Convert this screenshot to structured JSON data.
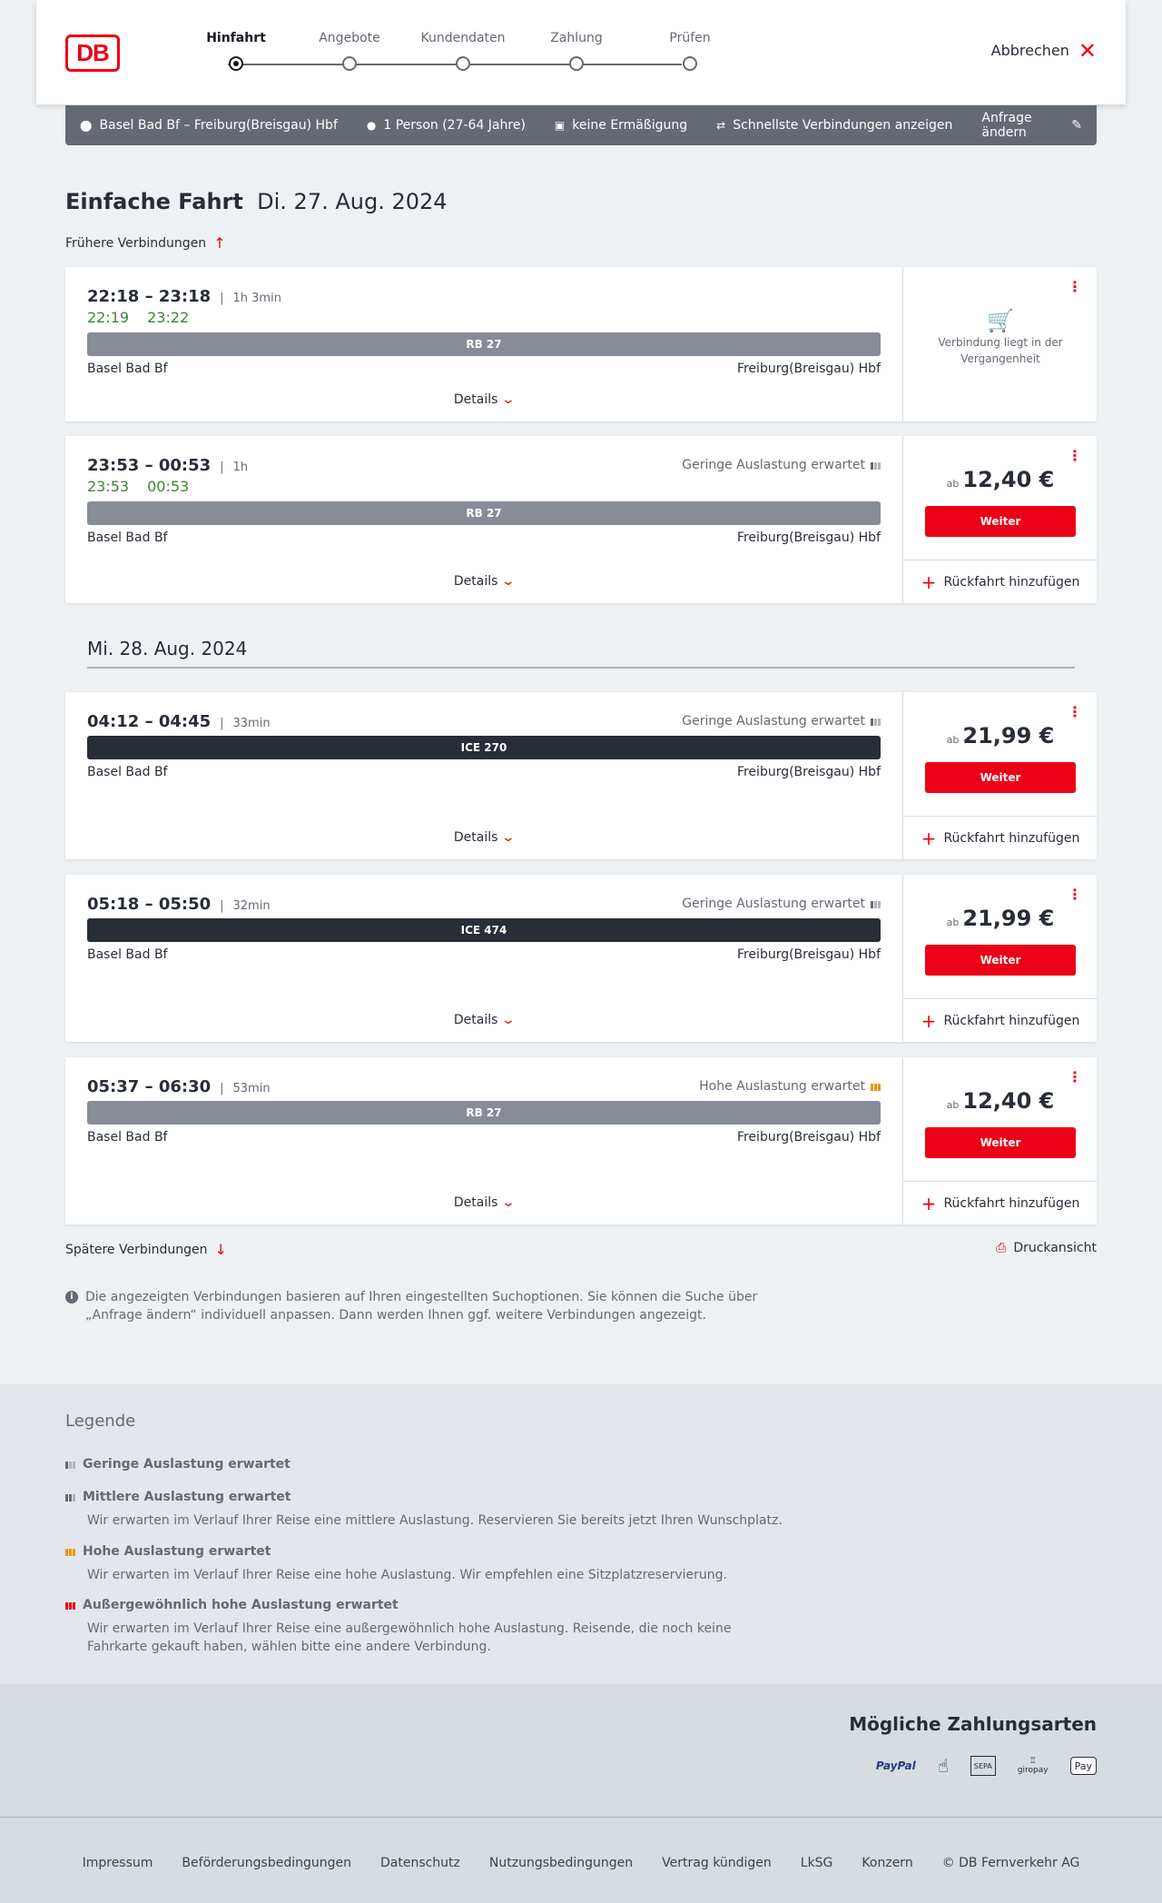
{
  "header": {
    "logo": "DB",
    "steps": [
      {
        "label": "Hinfahrt",
        "active": true
      },
      {
        "label": "Angebote",
        "active": false
      },
      {
        "label": "Kundendaten",
        "active": false
      },
      {
        "label": "Zahlung",
        "active": false
      },
      {
        "label": "Prüfen",
        "active": false
      }
    ],
    "cancel_label": "Abbrechen"
  },
  "query": {
    "route": "Basel Bad Bf – Freiburg(Breisgau) Hbf",
    "persons": "1 Person (27-64 Jahre)",
    "discount": "keine Ermäßigung",
    "option": "Schnellste Verbindungen anzeigen",
    "edit_label": "Anfrage ändern"
  },
  "title": {
    "type": "Einfache Fahrt",
    "date": "Di. 27. Aug. 2024"
  },
  "earlier_label": "Frühere Verbindungen",
  "later_label": "Spätere Verbindungen",
  "print_label": "Druckansicht",
  "date_divider": "Mi. 28. Aug. 2024",
  "details_label": "Details",
  "weiter_label": "Weiter",
  "return_label": "Rückfahrt hinzufügen",
  "price_prefix": "ab",
  "connections": [
    {
      "times": "22:18 – 23:18",
      "duration": "1h 3min",
      "rt_dep": "22:19",
      "rt_arr": "23:22",
      "occupancy": "",
      "train": "RB 27",
      "train_type": "regional",
      "from": "Basel Bad Bf",
      "to": "Freiburg(Breisgau) Hbf",
      "past": true,
      "past_text": "Verbindung liegt in der Vergangenheit"
    },
    {
      "times": "23:53 – 00:53",
      "duration": "1h",
      "rt_dep": "23:53",
      "rt_arr": "00:53",
      "occupancy": "Geringe Auslastung erwartet",
      "train": "RB 27",
      "train_type": "regional",
      "from": "Basel Bad Bf",
      "to": "Freiburg(Breisgau) Hbf",
      "price": "12,40 €"
    },
    {
      "times": "04:12 – 04:45",
      "duration": "33min",
      "occupancy": "Geringe Auslastung erwartet",
      "train": "ICE 270",
      "train_type": "ice",
      "from": "Basel Bad Bf",
      "to": "Freiburg(Breisgau) Hbf",
      "price": "21,99 €"
    },
    {
      "times": "05:18 – 05:50",
      "duration": "32min",
      "occupancy": "Geringe Auslastung erwartet",
      "train": "ICE 474",
      "train_type": "ice",
      "from": "Basel Bad Bf",
      "to": "Freiburg(Breisgau) Hbf",
      "price": "21,99 €"
    },
    {
      "times": "05:37 – 06:30",
      "duration": "53min",
      "occupancy": "Hohe Auslastung erwartet",
      "train": "RB 27",
      "train_type": "regional",
      "from": "Basel Bad Bf",
      "to": "Freiburg(Breisgau) Hbf",
      "price": "12,40 €"
    }
  ],
  "info_text": "Die angezeigten Verbindungen basieren auf Ihren eingestellten Suchoptionen. Sie können die Suche über „Anfrage ändern“ individuell anpassen. Dann werden Ihnen ggf. weitere Verbindungen angezeigt.",
  "legend": {
    "title": "Legende",
    "items": [
      {
        "title": "Geringe Auslastung erwartet",
        "desc": ""
      },
      {
        "title": "Mittlere Auslastung erwartet",
        "desc": "Wir erwarten im Verlauf Ihrer Reise eine mittlere Auslastung. Reservieren Sie bereits jetzt Ihren Wunschplatz."
      },
      {
        "title": "Hohe Auslastung erwartet",
        "desc": "Wir erwarten im Verlauf Ihrer Reise eine hohe Auslastung. Wir empfehlen eine Sitzplatzreservierung."
      },
      {
        "title": "Außergewöhnlich hohe Auslastung erwartet",
        "desc": "Wir erwarten im Verlauf Ihrer Reise eine außergewöhnlich hohe Auslastung. Reisende, die noch keine Fahrkarte gekauft haben, wählen bitte eine andere Verbindung."
      }
    ]
  },
  "payment": {
    "title": "Mögliche Zahlungsarten",
    "methods": [
      "PayPal",
      "SEPA",
      "giropay",
      "Pay"
    ]
  },
  "footer": {
    "links": [
      "Impressum",
      "Beförderungsbedingungen",
      "Datenschutz",
      "Nutzungsbedingungen",
      "Vertrag kündigen",
      "LkSG",
      "Konzern",
      "© DB Fernverkehr AG"
    ]
  }
}
